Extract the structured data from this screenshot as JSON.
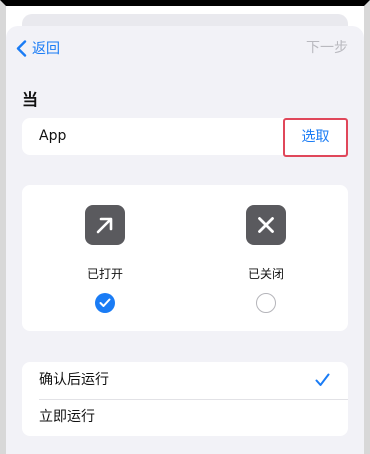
{
  "nav": {
    "back_label": "返回",
    "next_label": "下一步"
  },
  "section": {
    "title": "当"
  },
  "app_row": {
    "label": "App",
    "choose_label": "选取"
  },
  "states": [
    {
      "label": "已打开",
      "icon": "arrow-up-right-icon",
      "selected": true
    },
    {
      "label": "已关闭",
      "icon": "close-x-icon",
      "selected": false
    }
  ],
  "run_options": [
    {
      "label": "确认后运行",
      "selected": true
    },
    {
      "label": "立即运行",
      "selected": false
    }
  ],
  "colors": {
    "accent": "#1a7cf5",
    "highlight_border": "#e0475a",
    "icon_tile": "#5a5a5e",
    "disabled_text": "#b9b9bf",
    "background": "#f2f2f7"
  }
}
